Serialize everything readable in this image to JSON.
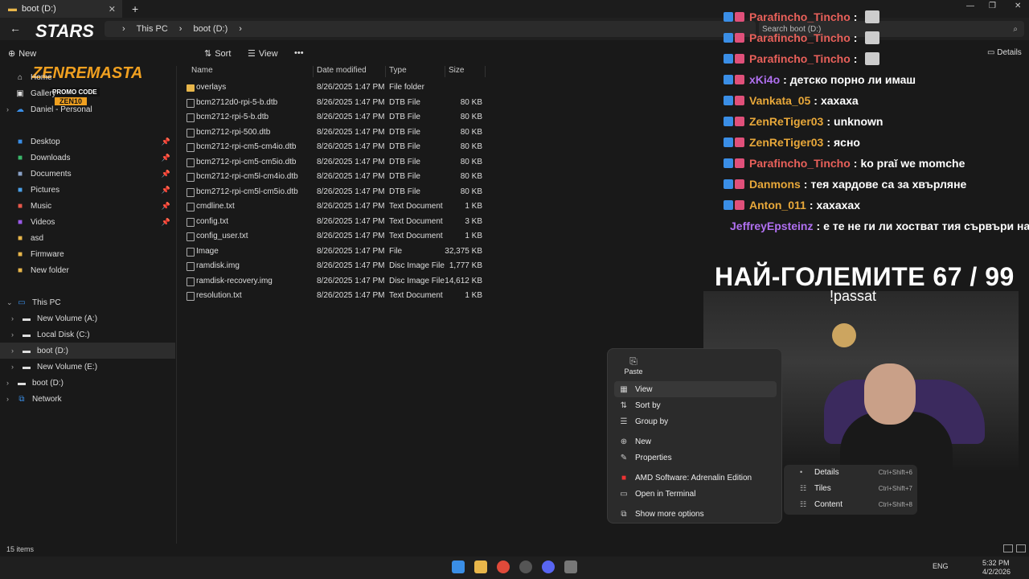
{
  "window": {
    "tab_title": "boot (D:)",
    "tab_close": "✕",
    "new_tab": "+",
    "min": "—",
    "max": "❐",
    "close": "✕"
  },
  "address": {
    "back": "←",
    "crumbs": [
      "This PC",
      "boot (D:)"
    ],
    "sep": "›",
    "search_placeholder": "Search boot (D:)",
    "search_icon": "search-icon"
  },
  "toolbar": {
    "new_label": "New",
    "sort_label": "Sort",
    "view_label": "View",
    "more_label": "•••",
    "details_label": "Details"
  },
  "sidebar": {
    "home": "Home",
    "gallery": "Gallery",
    "onedrive": "Daniel - Personal",
    "quick": [
      {
        "label": "Desktop",
        "icon": "desktop-icon",
        "color": "#3a8ee6"
      },
      {
        "label": "Downloads",
        "icon": "download-icon",
        "color": "#3ab86a"
      },
      {
        "label": "Documents",
        "icon": "documents-icon",
        "color": "#8aa2c8"
      },
      {
        "label": "Pictures",
        "icon": "pictures-icon",
        "color": "#4aa0e8"
      },
      {
        "label": "Music",
        "icon": "music-icon",
        "color": "#e8584a"
      },
      {
        "label": "Videos",
        "icon": "videos-icon",
        "color": "#9a5ae8"
      },
      {
        "label": "asd",
        "icon": "folder-icon",
        "color": "#e8b64a"
      },
      {
        "label": "Firmware",
        "icon": "folder-icon",
        "color": "#e8b64a"
      },
      {
        "label": "New folder",
        "icon": "folder-icon",
        "color": "#e8b64a"
      }
    ],
    "this_pc": "This PC",
    "drives": [
      "New Volume (A:)",
      "Local Disk (C:)",
      "boot (D:)",
      "New Volume (E:)"
    ],
    "boot_again": "boot (D:)",
    "network": "Network"
  },
  "columns": {
    "name": "Name",
    "date": "Date modified",
    "type": "Type",
    "size": "Size"
  },
  "files": [
    {
      "name": "overlays",
      "date": "8/26/2025 1:47 PM",
      "type": "File folder",
      "size": "",
      "folder": true
    },
    {
      "name": "bcm2712d0-rpi-5-b.dtb",
      "date": "8/26/2025 1:47 PM",
      "type": "DTB File",
      "size": "80 KB"
    },
    {
      "name": "bcm2712-rpi-5-b.dtb",
      "date": "8/26/2025 1:47 PM",
      "type": "DTB File",
      "size": "80 KB"
    },
    {
      "name": "bcm2712-rpi-500.dtb",
      "date": "8/26/2025 1:47 PM",
      "type": "DTB File",
      "size": "80 KB"
    },
    {
      "name": "bcm2712-rpi-cm5-cm4io.dtb",
      "date": "8/26/2025 1:47 PM",
      "type": "DTB File",
      "size": "80 KB"
    },
    {
      "name": "bcm2712-rpi-cm5-cm5io.dtb",
      "date": "8/26/2025 1:47 PM",
      "type": "DTB File",
      "size": "80 KB"
    },
    {
      "name": "bcm2712-rpi-cm5l-cm4io.dtb",
      "date": "8/26/2025 1:47 PM",
      "type": "DTB File",
      "size": "80 KB"
    },
    {
      "name": "bcm2712-rpi-cm5l-cm5io.dtb",
      "date": "8/26/2025 1:47 PM",
      "type": "DTB File",
      "size": "80 KB"
    },
    {
      "name": "cmdline.txt",
      "date": "8/26/2025 1:47 PM",
      "type": "Text Document",
      "size": "1 KB"
    },
    {
      "name": "config.txt",
      "date": "8/26/2025 1:47 PM",
      "type": "Text Document",
      "size": "3 KB"
    },
    {
      "name": "config_user.txt",
      "date": "8/26/2025 1:47 PM",
      "type": "Text Document",
      "size": "1 KB"
    },
    {
      "name": "Image",
      "date": "8/26/2025 1:47 PM",
      "type": "File",
      "size": "32,375 KB"
    },
    {
      "name": "ramdisk.img",
      "date": "8/26/2025 1:47 PM",
      "type": "Disc Image File",
      "size": "1,777 KB"
    },
    {
      "name": "ramdisk-recovery.img",
      "date": "8/26/2025 1:47 PM",
      "type": "Disc Image File",
      "size": "14,612 KB"
    },
    {
      "name": "resolution.txt",
      "date": "8/26/2025 1:47 PM",
      "type": "Text Document",
      "size": "1 KB"
    }
  ],
  "status": {
    "count": "15 items"
  },
  "context_menu": {
    "paste": "Paste",
    "view": "View",
    "sort_by": "Sort by",
    "group_by": "Group by",
    "new": "New",
    "properties": "Properties",
    "amd": "AMD Software: Adrenalin Edition",
    "terminal": "Open in Terminal",
    "more": "Show more options"
  },
  "view_submenu": [
    {
      "label": "Details",
      "shortcut": "Ctrl+Shift+6"
    },
    {
      "label": "Tiles",
      "shortcut": "Ctrl+Shift+7"
    },
    {
      "label": "Content",
      "shortcut": "Ctrl+Shift+8"
    }
  ],
  "logo": {
    "stars": "STARS",
    "brand": "ZENREMASTA",
    "promo": "PROMO CODE",
    "code": "ZEN10"
  },
  "chat": [
    {
      "user": "Parafincho_Tincho",
      "sep": ":",
      "text": "",
      "color": "#e8605a",
      "avatar": true
    },
    {
      "user": "Parafincho_Tincho",
      "sep": ":",
      "text": "",
      "color": "#e8605a",
      "avatar": true
    },
    {
      "user": "Parafincho_Tincho",
      "sep": ":",
      "text": "",
      "color": "#e8605a",
      "avatar": true
    },
    {
      "user": "xKi4o",
      "sep": ":",
      "text": "детско порно ли имаш",
      "color": "#b070f0"
    },
    {
      "user": "Vankata_05",
      "sep": ":",
      "text": "хахаха",
      "color": "#e8a83a"
    },
    {
      "user": "ZenReTiger03",
      "sep": ":",
      "text": "unknown",
      "color": "#e8a83a"
    },
    {
      "user": "ZenReTiger03",
      "sep": ":",
      "text": "ясно",
      "color": "#e8a83a"
    },
    {
      "user": "Parafincho_Tincho",
      "sep": ":",
      "text": "ko praĭ we momche",
      "color": "#e8605a"
    },
    {
      "user": "Danmons",
      "sep": ":",
      "text": "тея хардове са за хвърляне",
      "color": "#e8a83a"
    },
    {
      "user": "Anton_011",
      "sep": ":",
      "text": "хахахах",
      "color": "#e8a83a"
    },
    {
      "user": "JeffreyEpsteinz",
      "sep": ":",
      "text": "е те не ги ли хостват тия сървъри на",
      "color": "#b070f0"
    }
  ],
  "overlay": {
    "title": "НАЙ-ГОЛЕМИТЕ 67 / 99",
    "subtitle": "!passat"
  },
  "tray": {
    "lang": "ENG",
    "time": "5:32 PM",
    "date": "4/2/2026"
  }
}
